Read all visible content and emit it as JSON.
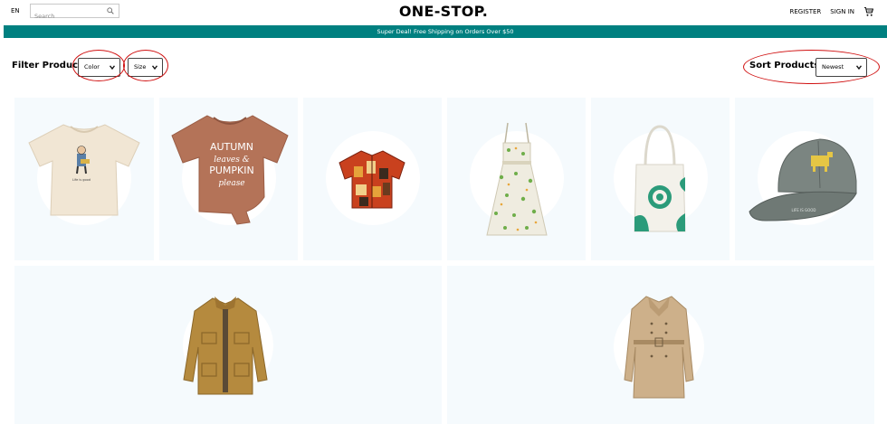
{
  "navbar": {
    "lang": "EN",
    "search_placeholder": "Search",
    "logo": "ONE-STOP.",
    "register": "REGISTER",
    "signin": "SIGN IN"
  },
  "announcement": "Super Deal! Free Shipping on Orders Over $50",
  "filters": {
    "label": "Filter Products:",
    "color": "Color",
    "size": "Size",
    "sort_label": "Sort Products:",
    "sort": "Newest"
  },
  "products": [
    {
      "name": "t-shirt"
    },
    {
      "name": "autumn-tee"
    },
    {
      "name": "hawaiian-shirt"
    },
    {
      "name": "sundress"
    },
    {
      "name": "tote-bag"
    },
    {
      "name": "cap"
    },
    {
      "name": "jacket"
    },
    {
      "name": "trench-coat"
    }
  ],
  "tee_print": [
    "AUTUMN",
    "leaves &",
    "PUMPKIN",
    "please"
  ],
  "colors": {
    "teal": "#008080",
    "card_bg": "#f5fafd",
    "annotation": "#d01010"
  }
}
